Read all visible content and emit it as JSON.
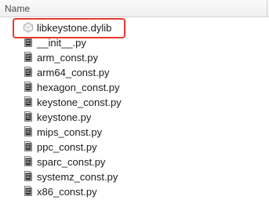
{
  "header": {
    "name_label": "Name"
  },
  "files": [
    {
      "name": "libkeystone.dylib",
      "type": "dylib",
      "icon": "dylib-file-icon"
    },
    {
      "name": "__init__.py",
      "type": "py",
      "icon": "python-file-icon"
    },
    {
      "name": "arm_const.py",
      "type": "py",
      "icon": "python-file-icon"
    },
    {
      "name": "arm64_const.py",
      "type": "py",
      "icon": "python-file-icon"
    },
    {
      "name": "hexagon_const.py",
      "type": "py",
      "icon": "python-file-icon"
    },
    {
      "name": "keystone_const.py",
      "type": "py",
      "icon": "python-file-icon"
    },
    {
      "name": "keystone.py",
      "type": "py",
      "icon": "python-file-icon"
    },
    {
      "name": "mips_const.py",
      "type": "py",
      "icon": "python-file-icon"
    },
    {
      "name": "ppc_const.py",
      "type": "py",
      "icon": "python-file-icon"
    },
    {
      "name": "sparc_const.py",
      "type": "py",
      "icon": "python-file-icon"
    },
    {
      "name": "systemz_const.py",
      "type": "py",
      "icon": "python-file-icon"
    },
    {
      "name": "x86_const.py",
      "type": "py",
      "icon": "python-file-icon"
    }
  ],
  "highlight_color": "#e53a2e"
}
